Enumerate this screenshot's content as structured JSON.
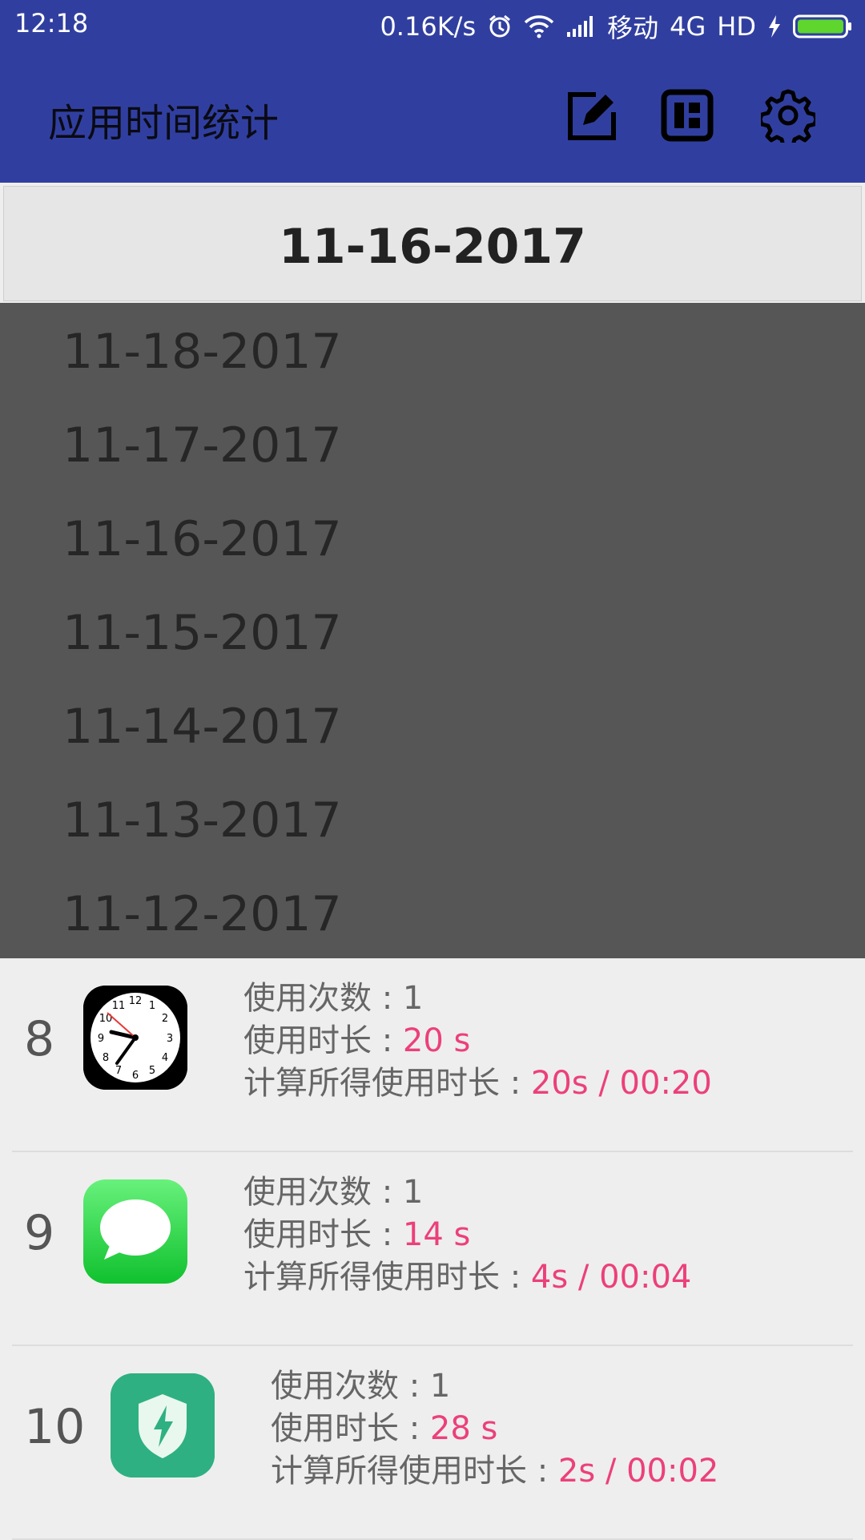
{
  "status_bar": {
    "time": "12:18",
    "speed": "0.16K/s",
    "carrier": "移动",
    "network": "4G",
    "hd": "HD",
    "icons": [
      "alarm-icon",
      "wifi-icon",
      "signal-icon",
      "charging-icon",
      "battery-icon"
    ]
  },
  "app_bar": {
    "title": "应用时间统计",
    "actions": [
      "edit-icon",
      "dashboard-icon",
      "settings-icon"
    ]
  },
  "spinner": {
    "selected": "11-16-2017"
  },
  "dropdown": {
    "options": [
      "11-18-2017",
      "11-17-2017",
      "11-16-2017",
      "11-15-2017",
      "11-14-2017",
      "11-13-2017",
      "11-12-2017"
    ]
  },
  "list": {
    "count_label": "使用次数 : ",
    "duration_label": "使用时长 : ",
    "calc_label": "计算所得使用时长 : ",
    "items": [
      {
        "rank": "8",
        "icon": "clock-app-icon",
        "count": "1",
        "duration": "20 s",
        "calc": "20s / 00:20"
      },
      {
        "rank": "9",
        "icon": "messages-app-icon",
        "count": "1",
        "duration": "14 s",
        "calc": "4s / 00:04"
      },
      {
        "rank": "10",
        "icon": "security-app-icon",
        "count": "1",
        "duration": "28 s",
        "calc": "2s / 00:02"
      }
    ]
  },
  "colors": {
    "primary": "#303F9F",
    "accent_value": "#EC407A",
    "dropdown_bg": "#565656",
    "battery": "#5ED62E"
  }
}
